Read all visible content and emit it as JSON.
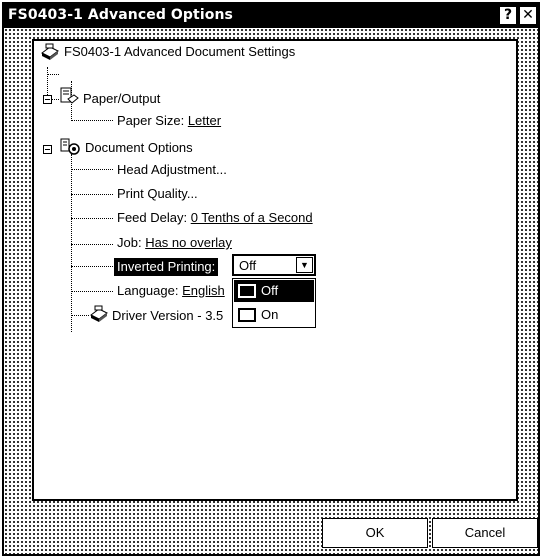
{
  "window": {
    "title": "FS0403-1 Advanced Options",
    "help_button": "?",
    "close_button": "✕"
  },
  "tree": {
    "root": "FS0403-1 Advanced Document Settings",
    "paper_output": {
      "label": "Paper/Output",
      "paper_size_label": "Paper Size: ",
      "paper_size_value": "Letter"
    },
    "document_options": {
      "label": "Document Options",
      "head_adjustment": "Head Adjustment...",
      "print_quality": "Print Quality...",
      "feed_delay_label": "Feed Delay: ",
      "feed_delay_value": "0 Tenths of a Second",
      "job_label": "Job: ",
      "job_value": "Has no overlay",
      "inverted_printing_label": "Inverted Printing:",
      "language_label": "Language: ",
      "language_value": "English"
    },
    "driver_version": "Driver Version - 3.5"
  },
  "inverted_combo": {
    "selected": "Off",
    "options": [
      "Off",
      "On"
    ]
  },
  "buttons": {
    "ok": "OK",
    "cancel": "Cancel"
  }
}
